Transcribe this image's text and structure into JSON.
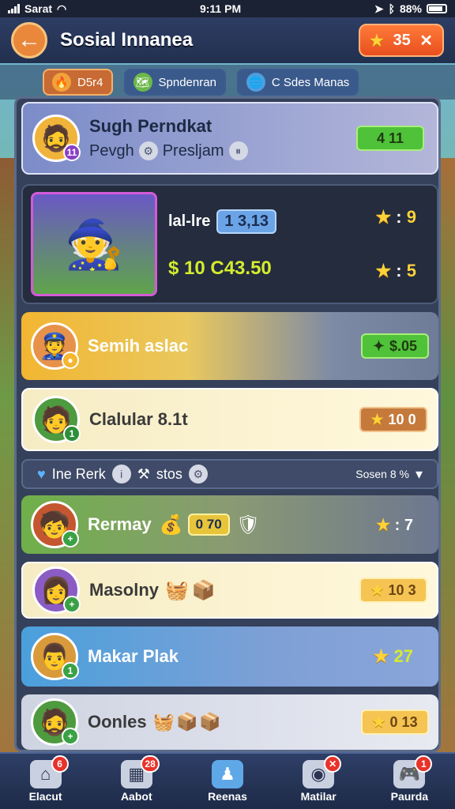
{
  "status_bar": {
    "carrier": "Sarat",
    "time": "9:11 PM",
    "battery": "88%"
  },
  "header": {
    "title": "Sosial Innanea",
    "coins": "35",
    "coin_star": "★",
    "coin_close": "✕"
  },
  "tabs": [
    {
      "label": "D5r4",
      "icon": "fire-icon"
    },
    {
      "label": "Spndenran",
      "icon": "map-icon"
    },
    {
      "label": "C Sdes Manas",
      "icon": "globe-icon"
    }
  ],
  "profile": {
    "name": "Sugh Perndkat",
    "subtitle": "Pevgh",
    "subtitle2": "Presljam",
    "value": "4 11",
    "level": "11"
  },
  "featured": {
    "label": "lal-lre",
    "chip": "1 3,13",
    "money": "$ 10 C43.50",
    "stat1": "9",
    "stat2": "5"
  },
  "rows": [
    {
      "name": "Semih aslac",
      "value": "$.05"
    },
    {
      "name": "Clalular 8.1t",
      "value": "10 0"
    }
  ],
  "divider": {
    "label": "Ine Rerk",
    "label2": "stos",
    "sort": "Sosen 8 %"
  },
  "rows2": [
    {
      "name": "Rermay",
      "chip": "0 70",
      "value": ": 7"
    },
    {
      "name": "Masolny",
      "value": "10 3"
    },
    {
      "name": "Makar Plak",
      "value": "27"
    },
    {
      "name": "Oonles",
      "value": "0 13"
    }
  ],
  "nav": [
    {
      "label": "Elacut",
      "badge": "6",
      "icon": "house-icon"
    },
    {
      "label": "Aabot",
      "badge": "28",
      "icon": "grid-icon"
    },
    {
      "label": "Reenas",
      "badge": "",
      "icon": "pawn-icon"
    },
    {
      "label": "Matilar",
      "badge": "✕",
      "icon": "camera-icon"
    },
    {
      "label": "Paurda",
      "badge": "1",
      "icon": "gamepad-icon"
    }
  ]
}
